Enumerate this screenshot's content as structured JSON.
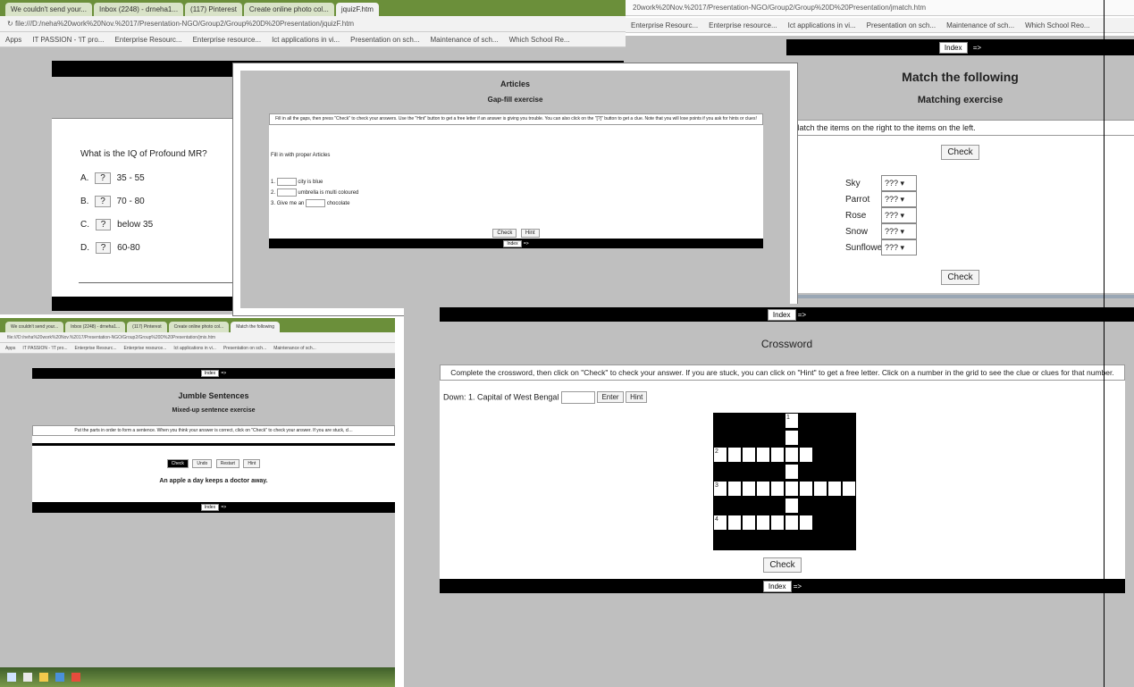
{
  "quiz": {
    "tabs": [
      "We couldn't send your...",
      "Inbox (2248) - drneha1...",
      "(117) Pinterest",
      "Create online photo col...",
      "jquizF.htm"
    ],
    "address": "file:///D:/neha%20work%20Nov.%2017/Presentation-NGO/Group2/Group%20D%20Presentation/jquizF.htm",
    "bookmarks": [
      "Apps",
      "IT PASSION - 'IT pro...",
      "Enterprise Resourc...",
      "Enterprise resource...",
      "Ict applications in vi...",
      "Presentation on sch...",
      "Maintenance of sch...",
      "Which School Re..."
    ],
    "question": "What is the IQ of Profound MR?",
    "options": [
      {
        "letter": "A",
        "mark": "?",
        "text": "35 - 55"
      },
      {
        "letter": "B",
        "mark": "?",
        "text": "70 - 80"
      },
      {
        "letter": "C",
        "mark": "?",
        "text": "below 35"
      },
      {
        "letter": "D",
        "mark": "?",
        "text": "60-80"
      }
    ]
  },
  "gapfill": {
    "title": "Articles",
    "subtitle": "Gap-fill exercise",
    "instructions": "Fill in all the gaps, then press \"Check\" to check your answers. Use the \"Hint\" button to get a free letter if an answer is giving you trouble. You can also click on the \"[?]\" button to get a clue. Note that you will lose points if you ask for hints or clues!",
    "prompt": "Fill in with proper Articles",
    "lines": [
      {
        "num": "1.",
        "text": "city is blue"
      },
      {
        "num": "2.",
        "text": "umbrella is multi coloured"
      },
      {
        "num": "3.",
        "pre": "Give me an",
        "text": "chocolate"
      }
    ],
    "check": "Check",
    "hint": "Hint",
    "nav_index": "Index",
    "nav_next": "=>"
  },
  "match": {
    "address": "20work%20Nov.%2017/Presentation-NGO/Group2/Group%20D%20Presentation/jmatch.htm",
    "bookmarks": [
      "Enterprise Resourc...",
      "Enterprise resource...",
      "Ict applications in vi...",
      "Presentation on sch...",
      "Maintenance of sch...",
      "Which School Reo..."
    ],
    "nav_index": "Index",
    "nav_next": "=>",
    "title": "Match the following",
    "subtitle": "Matching exercise",
    "instructions": "Match the items on the right to the items on the left.",
    "check": "Check",
    "items": [
      "Sky",
      "Parrot",
      "Rose",
      "Snow",
      "Sunflower"
    ],
    "placeholder": "???"
  },
  "jumble": {
    "tabs": [
      "We couldn't send your...",
      "Inbox (2248) - drneha1...",
      "(117) Pinterest",
      "Create online photo col...",
      "Match the following"
    ],
    "address": "file:///D:/neha%20work%20Nov.%2017/Presentation-NGO/Group2/Group%20D%20Presentation/jmix.htm",
    "bookmarks": [
      "Apps",
      "IT PASSION - 'IT pro...",
      "Enterprise Resourc...",
      "Enterprise resource...",
      "Ict applications in vi...",
      "Presentation on sch...",
      "Maintenance of sch..."
    ],
    "nav_index": "Index",
    "nav_next": "=>",
    "title": "Jumble Sentences",
    "subtitle": "Mixed-up sentence exercise",
    "instructions": "Put the parts in order to form a sentence. When you think your answer is correct, click on \"Check\" to check your answer. If you are stuck, cl...",
    "buttons": [
      "Check",
      "Undo",
      "Restart",
      "Hint"
    ],
    "sentence": "An apple a day keeps a doctor away."
  },
  "crossword": {
    "nav_index": "Index",
    "nav_next": "=>",
    "title": "Crossword",
    "instructions": "Complete the crossword, then click on \"Check\" to check your answer. If you are stuck, you can click on \"Hint\" to get a free letter. Click on a number in the grid to see the clue or clues for that number.",
    "clue": "Down: 1. Capital of West Bengal",
    "enter": "Enter",
    "hint": "Hint",
    "check": "Check",
    "numbers": [
      "1",
      "2",
      "3",
      "4"
    ]
  }
}
